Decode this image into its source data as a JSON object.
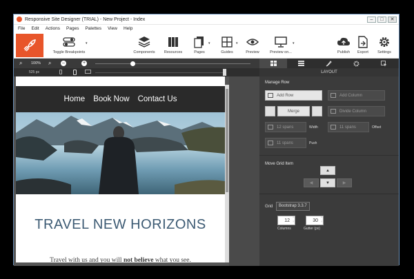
{
  "window": {
    "title": "Responsive Site Designer (TRIAL) - New Project - Index",
    "minimize": "–",
    "maximize": "□",
    "close": "✕"
  },
  "menu": [
    "File",
    "Edit",
    "Actions",
    "Pages",
    "Palettes",
    "View",
    "Help"
  ],
  "toolbar": {
    "toggle_breakpoints": "Toggle Breakpoints",
    "components": "Components",
    "resources": "Resources",
    "pages": "Pages",
    "guides": "Guides",
    "preview": "Preview",
    "preview_on": "Preview on...",
    "publish": "Publish",
    "export": "Export",
    "settings": "Settings"
  },
  "zoom": {
    "level": "100%",
    "width": "525 px"
  },
  "panel": {
    "tab_label": "LAYOUT",
    "manage_row": "Manage Row",
    "add_row": "Add Row",
    "add_column": "Add Column",
    "merge": "Merge",
    "divide_column": "Divide Column",
    "spans_a": "12 spans",
    "width_label": "Width",
    "spans_b": "11 spans",
    "offset_label": "Offset",
    "spans_c": "11 spans",
    "push_label": "Push",
    "move_grid_item": "Move Grid Item",
    "grid_label": "Grid",
    "grid_value": "Bootstrap 3.3.7",
    "columns_value": "12",
    "columns_label": "Columns",
    "gutter_value": "30",
    "gutter_label": "Gutter (px)"
  },
  "site": {
    "nav": [
      "Home",
      "Book Now",
      "Contact Us"
    ],
    "headline": "TRAVEL NEW HORIZONS",
    "body_pre": "Travel with us and you will ",
    "body_bold": "not believe",
    "body_post": " what you see."
  },
  "colors": {
    "accent": "#e8552a",
    "headline": "#3c5a73",
    "panel_bg": "#3b3b3b",
    "nav_bg": "#2a2a2a"
  }
}
